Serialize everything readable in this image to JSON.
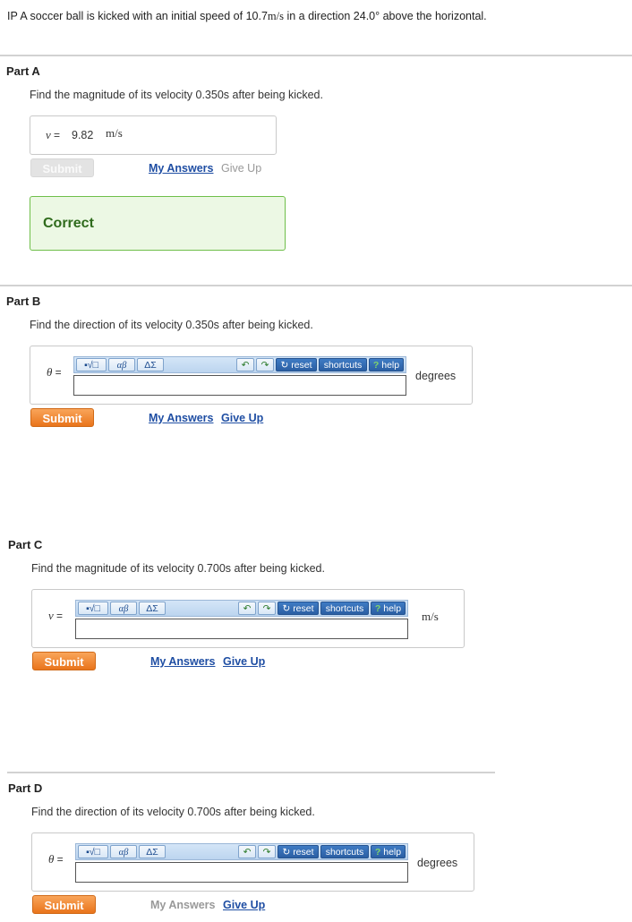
{
  "problem": {
    "prefix": "IP A soccer ball is kicked with an initial speed of 10.7",
    "speed_unit": "m/s",
    "suffix": " in a direction 24.0° above the horizontal."
  },
  "parts": {
    "a": {
      "title": "Part A",
      "question": "Find the magnitude of its velocity 0.350s after being kicked.",
      "var": "v",
      "eq": "=",
      "value": "9.82",
      "unit": "m/s",
      "submit": "Submit",
      "my_answers": "My Answers",
      "give_up": "Give Up",
      "feedback": "Correct"
    },
    "b": {
      "title": "Part B",
      "question": "Find the direction of its velocity 0.350s after being kicked.",
      "var": "θ",
      "eq": "=",
      "unit": "degrees",
      "submit": "Submit",
      "my_answers": "My Answers",
      "give_up": "Give Up"
    },
    "c": {
      "title": "Part C",
      "question": "Find the magnitude of its velocity 0.700s after being kicked.",
      "var": "v",
      "eq": "=",
      "unit": "m/s",
      "submit": "Submit",
      "my_answers": "My Answers",
      "give_up": "Give Up"
    },
    "d": {
      "title": "Part D",
      "question": "Find the direction of its velocity 0.700s after being kicked.",
      "var": "θ",
      "eq": "=",
      "unit": "degrees",
      "submit": "Submit",
      "my_answers": "My Answers",
      "give_up": "Give Up"
    }
  },
  "toolbar": {
    "templates": "▪√□",
    "greek": "αβ",
    "symbols": "ΔΣ",
    "reset": "reset",
    "shortcuts": "shortcuts",
    "help": "help",
    "help_mark": "?"
  },
  "colors": {
    "accent_button": "#e9741b",
    "link": "#1f4ea3",
    "correct_border": "#6fbf4a",
    "correct_text": "#2f6b1c"
  }
}
